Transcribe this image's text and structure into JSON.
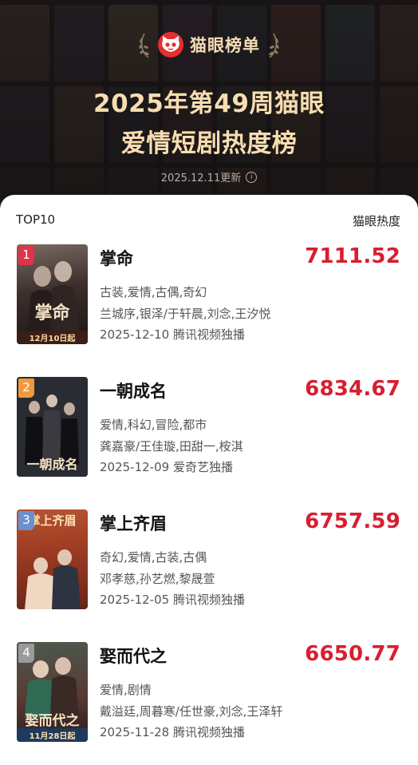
{
  "header": {
    "brand": "猫眼榜单",
    "title_line1": "2025年第49周猫眼",
    "title_line2": "爱情短剧热度榜",
    "updated": "2025.12.11更新"
  },
  "list": {
    "left_label": "TOP10",
    "right_label": "猫眼热度",
    "items": [
      {
        "rank": "1",
        "title": "掌命",
        "score": "7111.52",
        "genres": "古装,爱情,古偶,奇幻",
        "cast": "兰城序,银泽/于轩晨,刘念,王汐悦",
        "release": "2025-12-10 腾讯视频独播",
        "poster_text": "掌命",
        "poster_caption": "12月10日起",
        "badge_color": "#e0334a"
      },
      {
        "rank": "2",
        "title": "一朝成名",
        "score": "6834.67",
        "genres": "爱情,科幻,冒险,都市",
        "cast": "龚嘉豪/王佳璇,田甜一,桉淇",
        "release": "2025-12-09 爱奇艺独播",
        "poster_text": "一朝成名",
        "poster_caption": "",
        "badge_color": "#f09a3a"
      },
      {
        "rank": "3",
        "title": "掌上齐眉",
        "score": "6757.59",
        "genres": "奇幻,爱情,古装,古偶",
        "cast": "邓孝慈,孙艺燃,黎晟萱",
        "release": "2025-12-05 腾讯视频独播",
        "poster_text": "掌上齐眉",
        "poster_caption": "",
        "badge_color": "#6d8fd0"
      },
      {
        "rank": "4",
        "title": "娶而代之",
        "score": "6650.77",
        "genres": "爱情,剧情",
        "cast": "戴溢廷,周暮寒/任世豪,刘念,王泽轩",
        "release": "2025-11-28 腾讯视频独播",
        "poster_text": "娶而代之",
        "poster_caption": "11月28日起",
        "badge_color": "#9a9a9a"
      }
    ]
  }
}
